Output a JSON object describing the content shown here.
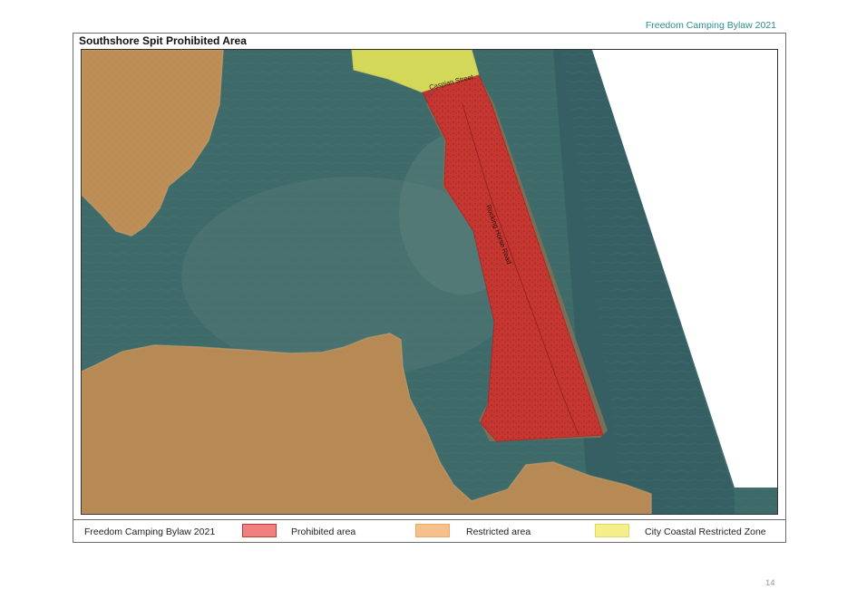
{
  "header": {
    "document_title": "Freedom Camping Bylaw 2021"
  },
  "map": {
    "title": "Southshore Spit Prohibited Area",
    "labels": {
      "street_1": "Caspian Street",
      "street_2": "Rocking Horse Road"
    }
  },
  "legend": {
    "bylaw_label": "Freedom Camping Bylaw 2021",
    "items": [
      {
        "label": "Prohibited area",
        "color": "#f08080",
        "border": "#c0392b"
      },
      {
        "label": "Restricted area",
        "color": "#f5c08c",
        "border": "#e8a868"
      },
      {
        "label": "City Coastal Restricted Zone",
        "color": "#f4ef8a",
        "border": "#e0d860"
      }
    ]
  },
  "footer": {
    "page_number": "14"
  },
  "colors": {
    "water": "#3f6a6a",
    "sea": "#3a6466",
    "prohibited_overlay": "#e02525",
    "restricted_overlay": "#d8a060",
    "coastal_zone_overlay": "#efec55",
    "accent_teal": "#2a8f8f"
  }
}
